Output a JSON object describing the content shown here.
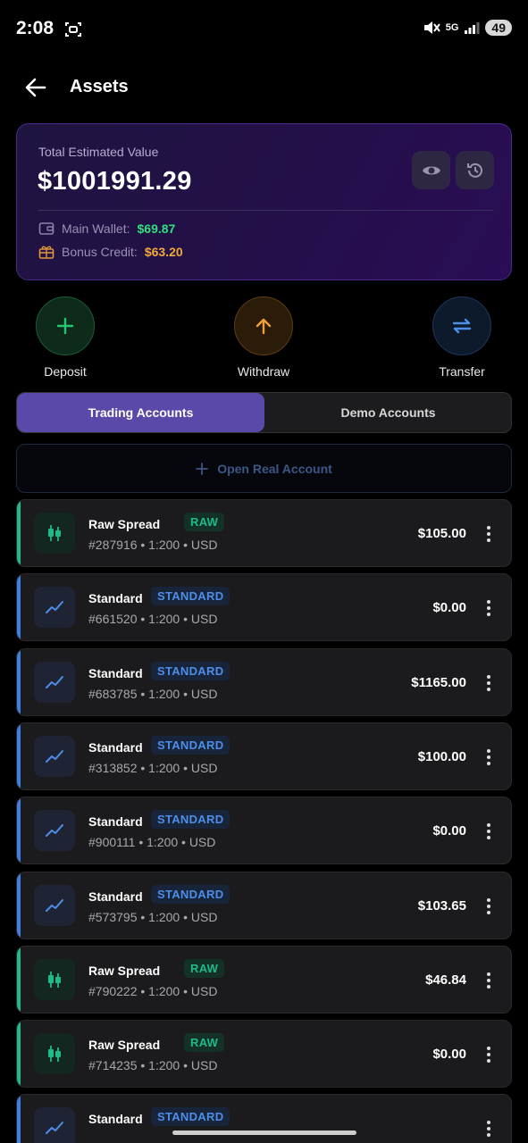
{
  "status_bar": {
    "time": "2:08",
    "network": "5G",
    "battery": "49"
  },
  "header": {
    "title": "Assets"
  },
  "summary": {
    "label": "Total Estimated Value",
    "amount": "$1001991.29",
    "main_wallet_label": "Main Wallet:",
    "main_wallet_value": "$69.87",
    "bonus_label": "Bonus Credit:",
    "bonus_value": "$63.20"
  },
  "actions": [
    {
      "label": "Deposit"
    },
    {
      "label": "Withdraw"
    },
    {
      "label": "Transfer"
    }
  ],
  "tabs": {
    "active": "Trading Accounts",
    "inactive": "Demo Accounts"
  },
  "open_account": {
    "label": "Open Real Account"
  },
  "colors": {
    "raw_accent": "#1fb98a",
    "standard_accent": "#3f7fe0",
    "deposit_accent": "#22c76e",
    "withdraw_accent": "#f0a03a",
    "transfer_accent": "#4d8ee8",
    "tab_active": "#5a49a8"
  },
  "accounts": [
    {
      "type": "raw",
      "name": "Raw Spread",
      "badge": "RAW",
      "meta": "#287916 • 1:200 • USD",
      "balance": "$105.00",
      "icon": "candlestick-icon"
    },
    {
      "type": "standard",
      "name": "Standard",
      "badge": "STANDARD",
      "meta": "#661520 • 1:200 • USD",
      "balance": "$0.00",
      "icon": "trend-line-icon"
    },
    {
      "type": "standard",
      "name": "Standard",
      "badge": "STANDARD",
      "meta": "#683785 • 1:200 • USD",
      "balance": "$1165.00",
      "icon": "trend-line-icon"
    },
    {
      "type": "standard",
      "name": "Standard",
      "badge": "STANDARD",
      "meta": "#313852 • 1:200 • USD",
      "balance": "$100.00",
      "icon": "trend-line-icon"
    },
    {
      "type": "standard",
      "name": "Standard",
      "badge": "STANDARD",
      "meta": "#900111 • 1:200 • USD",
      "balance": "$0.00",
      "icon": "trend-line-icon"
    },
    {
      "type": "standard",
      "name": "Standard",
      "badge": "STANDARD",
      "meta": "#573795 • 1:200 • USD",
      "balance": "$103.65",
      "icon": "trend-line-icon"
    },
    {
      "type": "raw",
      "name": "Raw Spread",
      "badge": "RAW",
      "meta": "#790222 • 1:200 • USD",
      "balance": "$46.84",
      "icon": "candlestick-icon"
    },
    {
      "type": "raw",
      "name": "Raw Spread",
      "badge": "RAW",
      "meta": "#714235 • 1:200 • USD",
      "balance": "$0.00",
      "icon": "candlestick-icon"
    },
    {
      "type": "standard",
      "name": "Standard",
      "badge": "STANDARD",
      "meta": "",
      "balance": "",
      "icon": "trend-line-icon"
    }
  ]
}
